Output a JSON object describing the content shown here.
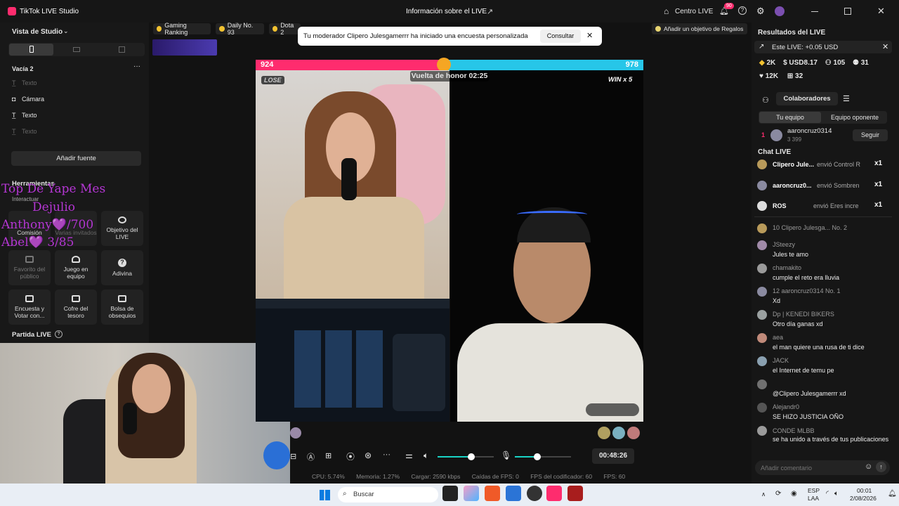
{
  "app": {
    "title": "TikTok LIVE Studio",
    "center_title": "Información sobre el LIVE",
    "centro_live": "Centro LIVE",
    "notif_count": "90"
  },
  "left": {
    "vista": "Vista de Studio",
    "scene": "Vacía 2",
    "sources": [
      "Texto",
      "Cámara",
      "Texto",
      "Texto"
    ],
    "add_source": "Añadir fuente",
    "herramientas": "Herramientas",
    "interactuar": "Interactuar",
    "tools": [
      {
        "label": "Comisión"
      },
      {
        "label": "Varias invitados"
      },
      {
        "label": "Objetivo del LIVE"
      },
      {
        "label": "Favorito del público"
      },
      {
        "label": "Juego en equipo"
      },
      {
        "label": "Adivina"
      },
      {
        "label": "Encuesta y Votar con..."
      },
      {
        "label": "Cofre del tesoro"
      },
      {
        "label": "Bolsa de obsequios"
      }
    ],
    "partida": "Partida LIVE"
  },
  "overlay": {
    "l1": "Top De Yape  Mes",
    "l2": "Dejulio",
    "l3": "Anthony💜/700",
    "l4": "Abel💜       3/85"
  },
  "chips": {
    "gaming": "Gaming Ranking",
    "daily": "Daily No. 93",
    "dota": "Dota 2",
    "goal": "Añadir un objetivo de Regalos"
  },
  "toast": {
    "text": "Tu moderador Clipero Julesgamerrr ha iniciado una encuesta personalizada",
    "button": "Consultar"
  },
  "battle": {
    "left_score": "924",
    "right_score": "978",
    "lose": "LOSE",
    "win": "WIN x 5",
    "timer": "Vuelta de honor 02:25",
    "left_frac": 0.486
  },
  "controls": {
    "time": "00:48:26",
    "vol": 0.6,
    "mic": 0.4
  },
  "status": {
    "cpu": "CPU:  5.74%",
    "mem": "Memoria:  1.27%",
    "load": "Cargar:  2590 kbps",
    "drops": "Caídas de FPS:  0",
    "enc": "FPS del codificador:  60",
    "fps": "FPS:  60"
  },
  "results": {
    "title": "Resultados del LIVE",
    "este": "Este LIVE: +0.05 USD",
    "s1": "2K",
    "s2": "USD8.17",
    "s3": "105",
    "s4": "31",
    "s5": "12K",
    "s6": "32",
    "collab": "Colaboradores",
    "tab1": "Tu equipo",
    "tab2": "Equipo oponente",
    "rank": "1",
    "user": "aaroncruz0314",
    "follow": "Seguir",
    "sub": "3  399"
  },
  "chat": {
    "title": "Chat LIVE",
    "gifts": [
      {
        "n": "Clipero Jule...",
        "a": "envió Control R",
        "x": "x1"
      },
      {
        "n": "aaroncruz0...",
        "a": "envió Sombren",
        "x": "x1"
      },
      {
        "n": "ROS",
        "a": "envió Eres incre",
        "x": "x1"
      }
    ],
    "msgs": [
      {
        "n": "10  Clipero Julesga...  No. 2",
        "m": ""
      },
      {
        "n": "JSteezy",
        "m": "Jules te amo"
      },
      {
        "n": "chamakito",
        "m": "cumple el reto era lluvia"
      },
      {
        "n": "12  aaroncruz0314  No. 1",
        "m": "Xd"
      },
      {
        "n": "Dp | KENEDI BIKERS",
        "m": "Otro día ganas xd"
      },
      {
        "n": "aea",
        "m": "el man quiere una rusa de ti dice"
      },
      {
        "n": "JACK",
        "m": "el Internet de temu pe"
      },
      {
        "n": "",
        "m": "@Clipero Julesgamerrr xd"
      },
      {
        "n": "Alejandr0",
        "m": "SE HIZO JUSTICIA OÑO"
      },
      {
        "n": "CONDE MLBB",
        "m": "se ha unido a través de tus publicaciones"
      }
    ],
    "placeholder": "Añadir comentario"
  },
  "taskbar": {
    "search": "Buscar",
    "lang1": "ESP",
    "lang2": "LAA",
    "time": "00:01",
    "date": "2/08/2026"
  },
  "colors": {
    "pink": "#fe2c6e",
    "cyan": "#27c6e8",
    "bg": "#121212"
  }
}
